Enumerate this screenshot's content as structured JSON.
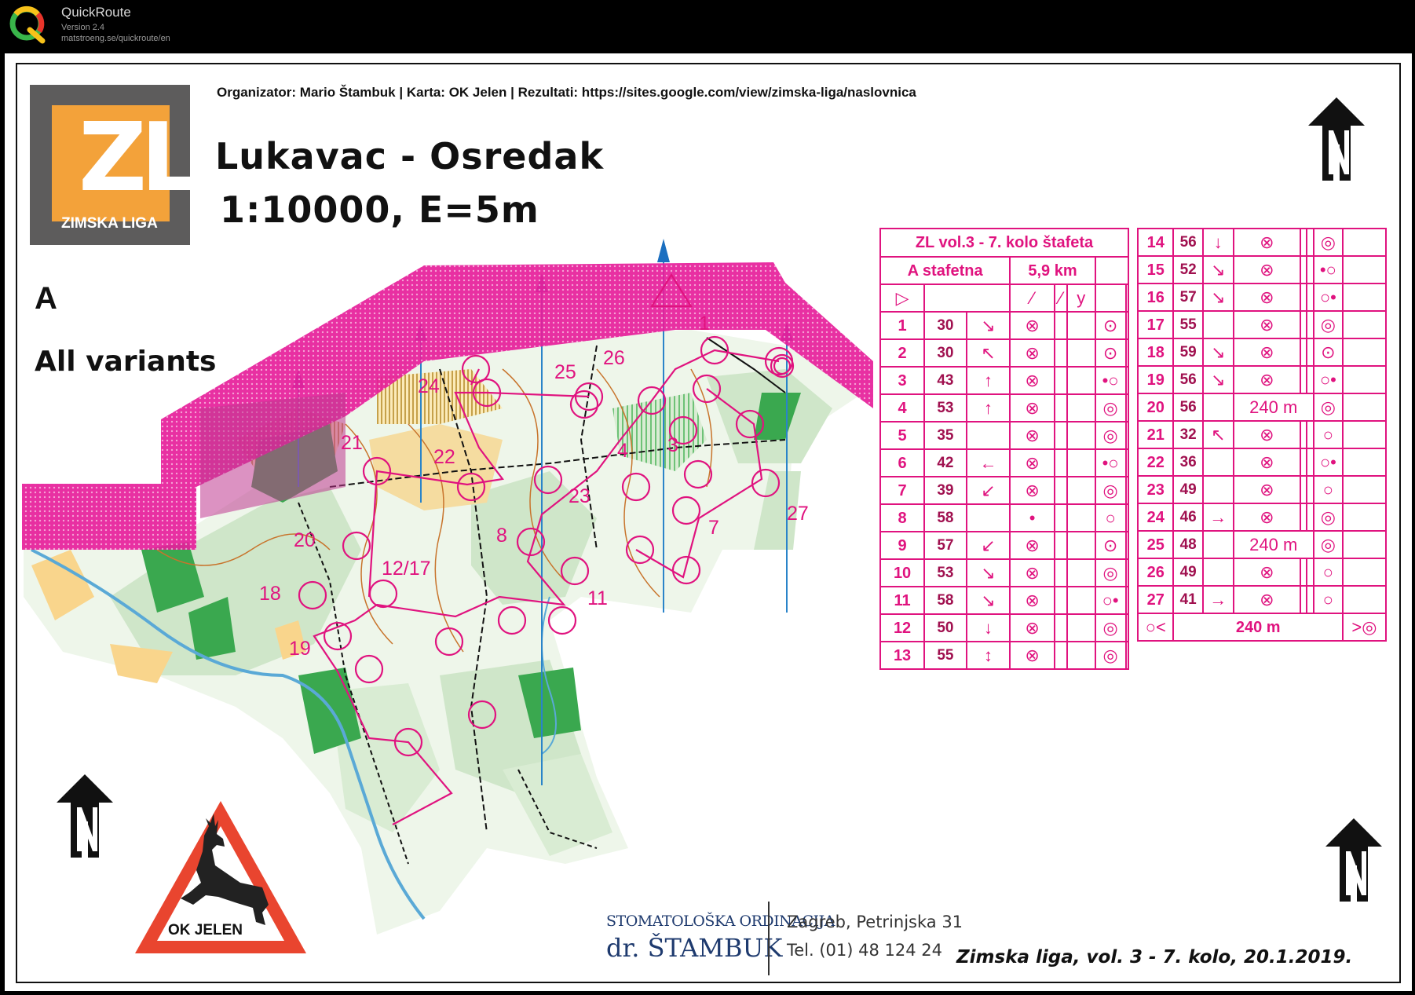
{
  "app": {
    "name": "QuickRoute",
    "version": "Version 2.4",
    "url": "matstroeng.se/quickroute/en"
  },
  "header": {
    "organizer": "Organizator: Mario Štambuk | Karta: OK Jelen | Rezultati: https://sites.google.com/view/zimska-liga/naslovnica",
    "title": "Lukavac - Osredak",
    "scale": "1:10000, E=5m",
    "course_letter": "A",
    "course_variant": "All variants"
  },
  "logo": {
    "letters": "ZL",
    "subtitle": "ZIMSKA LIGA"
  },
  "colors": {
    "overprint": "#e0137f",
    "logo_orange": "#f3a23a",
    "logo_grey": "#5d5c5c",
    "forest": "#cfe6c9",
    "green_dark": "#3aa84f",
    "open": "#f9d58c",
    "sign_red": "#e9452f"
  },
  "course": {
    "start_marker": "start-triangle",
    "controls": [
      {
        "label": "1"
      },
      {
        "label": "3"
      },
      {
        "label": "4"
      },
      {
        "label": "7"
      },
      {
        "label": "8"
      },
      {
        "label": "11"
      },
      {
        "label": "12/17"
      },
      {
        "label": "18"
      },
      {
        "label": "19"
      },
      {
        "label": "20"
      },
      {
        "label": "21"
      },
      {
        "label": "22"
      },
      {
        "label": "23"
      },
      {
        "label": "24"
      },
      {
        "label": "25"
      },
      {
        "label": "26"
      },
      {
        "label": "27"
      }
    ]
  },
  "description": {
    "title": "ZL vol.3 - 7. kolo štafeta",
    "class": "A stafetna",
    "length": "5,9 km",
    "left_rows": [
      {
        "n": "1",
        "code": "30",
        "d": "↘",
        "f": "⊗",
        "e": "⊙"
      },
      {
        "n": "2",
        "code": "30",
        "d": "↖",
        "f": "⊗",
        "e": "⊙"
      },
      {
        "n": "3",
        "code": "43",
        "d": "↑",
        "f": "⊗",
        "e": "•○"
      },
      {
        "n": "4",
        "code": "53",
        "d": "↑",
        "f": "⊗",
        "e": "◎"
      },
      {
        "n": "5",
        "code": "35",
        "d": "",
        "f": "⊗",
        "e": "◎"
      },
      {
        "n": "6",
        "code": "42",
        "d": "←",
        "f": "⊗",
        "e": "•○"
      },
      {
        "n": "7",
        "code": "39",
        "d": "↙",
        "f": "⊗",
        "e": "◎"
      },
      {
        "n": "8",
        "code": "58",
        "d": "",
        "f": "•",
        "e": "○"
      },
      {
        "n": "9",
        "code": "57",
        "d": "↙",
        "f": "⊗",
        "e": "⊙"
      },
      {
        "n": "10",
        "code": "53",
        "d": "↘",
        "f": "⊗",
        "e": "◎"
      },
      {
        "n": "11",
        "code": "58",
        "d": "↘",
        "f": "⊗",
        "e": "○•"
      },
      {
        "n": "12",
        "code": "50",
        "d": "↓",
        "f": "⊗",
        "e": "◎"
      },
      {
        "n": "13",
        "code": "55",
        "d": "↕",
        "f": "⊗",
        "e": "◎"
      }
    ],
    "right_rows": [
      {
        "n": "14",
        "code": "56",
        "d": "↓",
        "f": "⊗",
        "e": "◎"
      },
      {
        "n": "15",
        "code": "52",
        "d": "↘",
        "f": "⊗",
        "e": "•○"
      },
      {
        "n": "16",
        "code": "57",
        "d": "↘",
        "f": "⊗",
        "e": "○•"
      },
      {
        "n": "17",
        "code": "55",
        "d": "",
        "f": "⊗",
        "e": "◎"
      },
      {
        "n": "18",
        "code": "59",
        "d": "↘",
        "f": "⊗",
        "e": "⊙"
      },
      {
        "n": "19",
        "code": "56",
        "d": "↘",
        "f": "⊗",
        "e": "○•"
      },
      {
        "n": "20",
        "code": "56",
        "d": "",
        "f": "240 m",
        "e": "◎"
      },
      {
        "n": "21",
        "code": "32",
        "d": "↖",
        "f": "⊗",
        "e": "○"
      },
      {
        "n": "22",
        "code": "36",
        "d": "",
        "f": "⊗",
        "e": "○•"
      },
      {
        "n": "23",
        "code": "49",
        "d": "",
        "f": "⊗",
        "e": "○"
      },
      {
        "n": "24",
        "code": "46",
        "d": "→",
        "f": "⊗",
        "e": "◎"
      },
      {
        "n": "25",
        "code": "48",
        "d": "",
        "f": "240 m",
        "e": "◎"
      },
      {
        "n": "26",
        "code": "49",
        "d": "",
        "f": "⊗",
        "e": "○"
      },
      {
        "n": "27",
        "code": "41",
        "d": "→",
        "f": "⊗",
        "e": "○"
      }
    ],
    "finish": "240 m"
  },
  "sign": {
    "label": "OK JELEN"
  },
  "sponsor": {
    "line1": "STOMATOLOŠKA ORDINACIJA",
    "line2": "dr. ŠTAMBUK",
    "address": "Zagreb, Petrinjska 31",
    "phone": "Tel. (01) 48 124 24"
  },
  "footer": {
    "event": "Zimska liga, vol. 3 - 7. kolo, 20.1.2019."
  }
}
